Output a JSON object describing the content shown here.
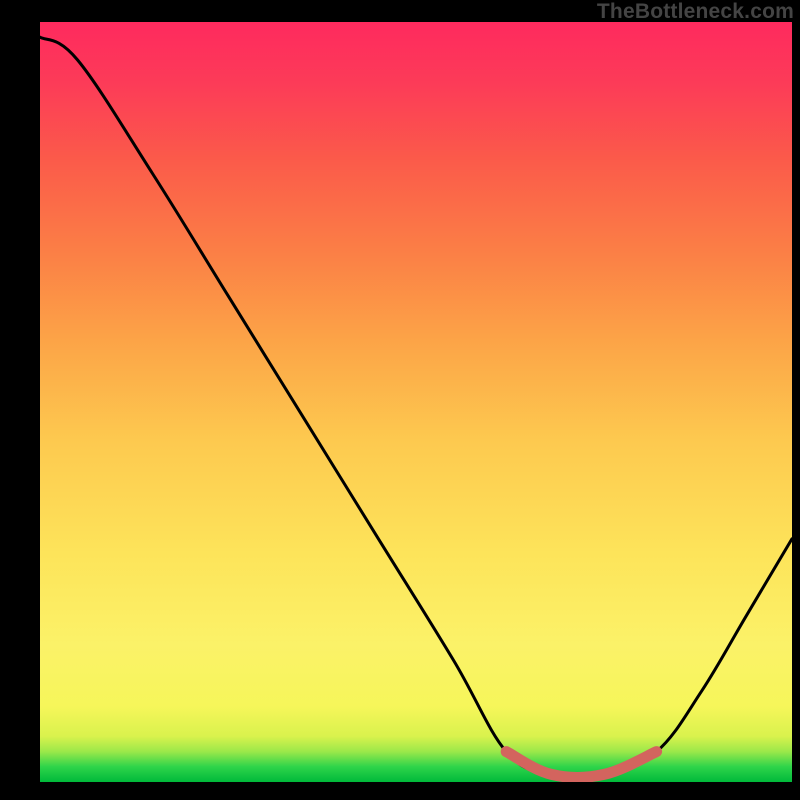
{
  "watermark": "TheBottleneck.com",
  "chart_data": {
    "type": "line",
    "title": "",
    "xlabel": "",
    "ylabel": "",
    "xlim": [
      0,
      100
    ],
    "ylim": [
      0,
      100
    ],
    "x": [
      0,
      5,
      15,
      25,
      35,
      45,
      55,
      62,
      68,
      75,
      82,
      88,
      94,
      100
    ],
    "values": [
      98,
      95,
      80,
      64,
      48,
      32,
      16,
      4,
      1,
      1,
      4,
      12,
      22,
      32
    ],
    "highlight_segment": {
      "x0": 62,
      "x1": 82
    },
    "gradient_stops": [
      {
        "pos": 0.0,
        "color": "#00b93b"
      },
      {
        "pos": 0.06,
        "color": "#d9f24d"
      },
      {
        "pos": 0.18,
        "color": "#fbf268"
      },
      {
        "pos": 0.45,
        "color": "#fdc94f"
      },
      {
        "pos": 0.7,
        "color": "#fb7e46"
      },
      {
        "pos": 1.0,
        "color": "#ff2a5e"
      }
    ]
  }
}
